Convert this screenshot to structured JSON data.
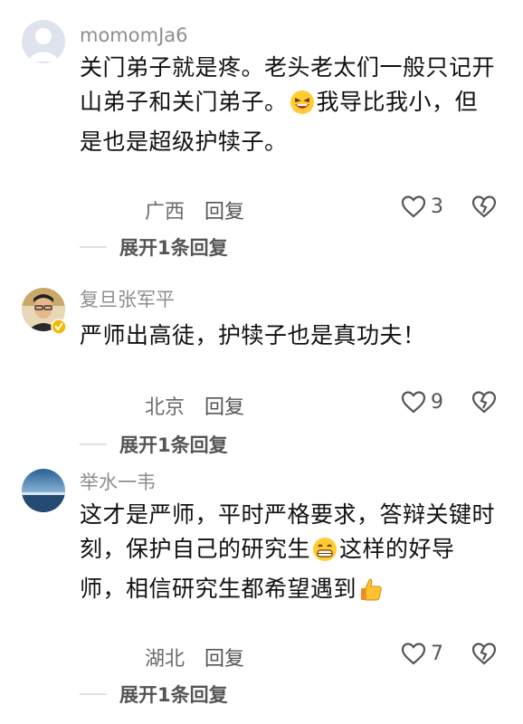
{
  "comments": [
    {
      "username": "momomJa6",
      "text_part1": "关门弟子就是疼。老头老太们一般只记开山弟子和关门弟子。",
      "emoji1": "laughing-emoji",
      "text_part2": "我导比我小，但是也是超级护犊子。",
      "location": "广西",
      "reply_label": "回复",
      "likes": "3",
      "expand_label": "展开1条回复"
    },
    {
      "username": "复旦张军平",
      "text_part1": "严师出高徒，护犊子也是真功夫！",
      "location": "北京",
      "reply_label": "回复",
      "likes": "9",
      "expand_label": "展开1条回复"
    },
    {
      "username": "举水一韦",
      "text_part1": "这才是严师，平时严格要求，答辩关键时刻，保护自己的研究生",
      "emoji1": "grinning-emoji",
      "text_part2": "这样的好导师，相信研究生都希望遇到",
      "emoji2": "thumbs-up-emoji",
      "location": "湖北",
      "reply_label": "回复",
      "likes": "7",
      "expand_label": "展开1条回复"
    }
  ],
  "colors": {
    "username": "#8e8e93",
    "text": "#111111",
    "meta": "#6b6b6b",
    "verified_badge": "#f5b800"
  }
}
